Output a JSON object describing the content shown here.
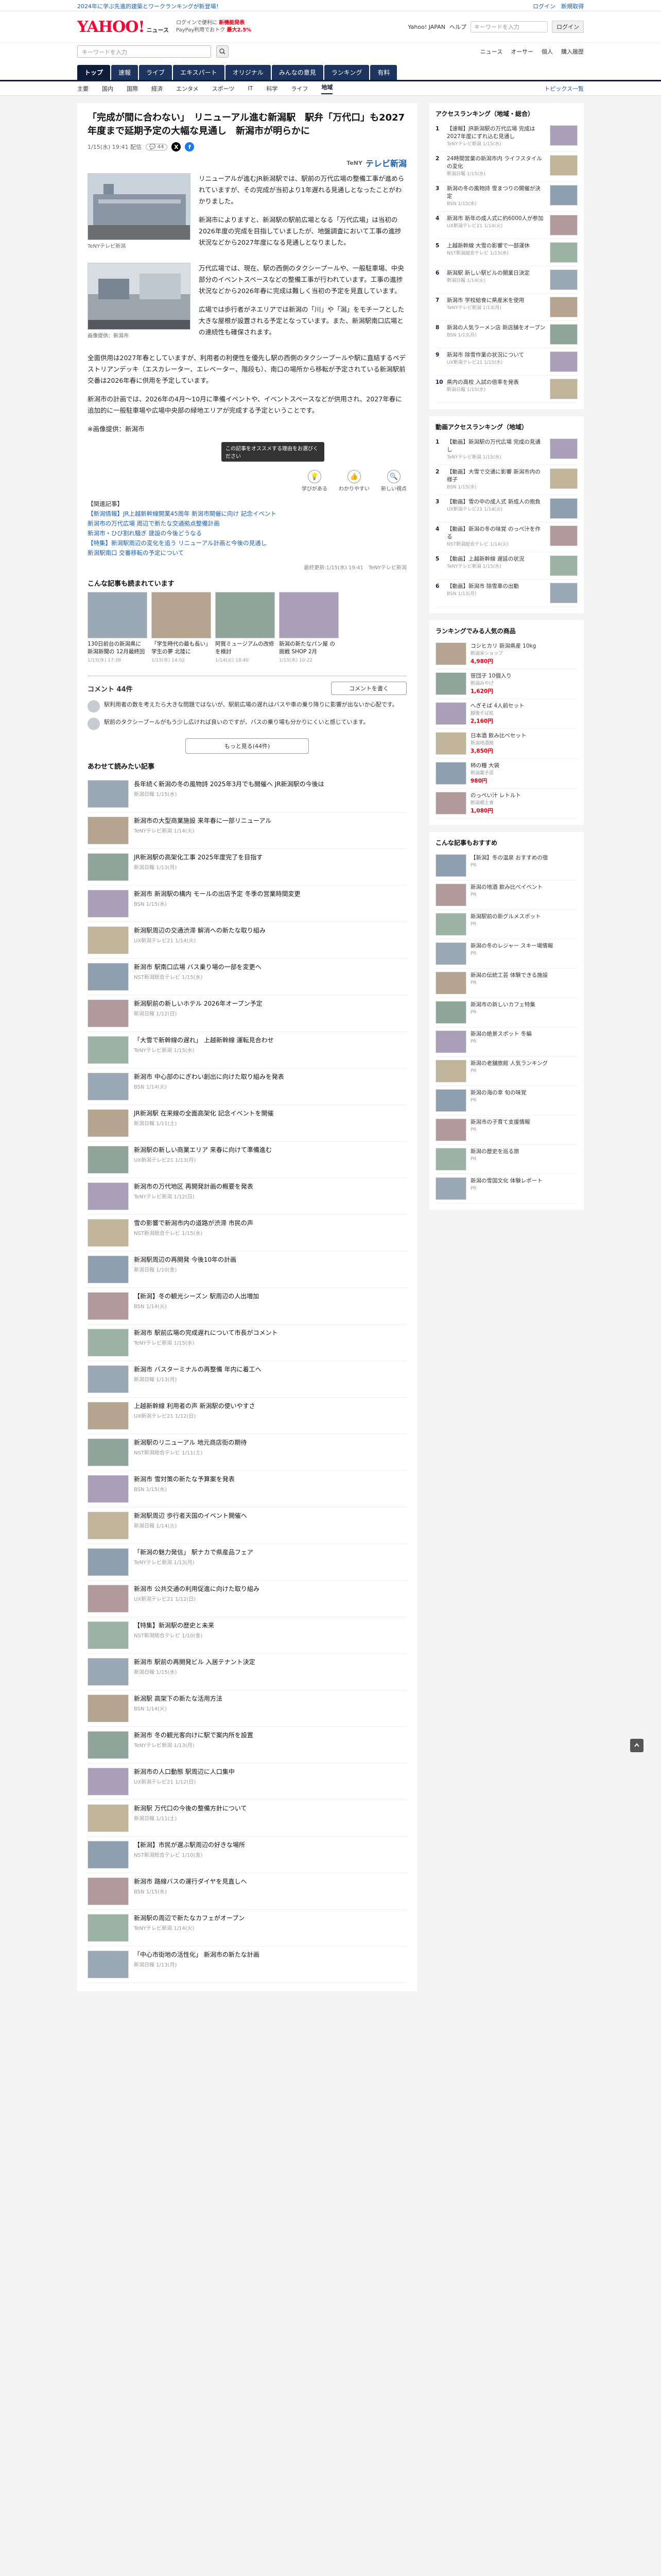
{
  "topbanner": {
    "left": "2024年に学ぶ先進的建築とワークランキングが新登場！",
    "right": "ログイン　新規取得"
  },
  "header": {
    "logo": "YAHOO!",
    "logo_sub": "ニュース",
    "links": [
      "ログインで便利に",
      "新機能発表",
      "PayPay利用でおトク",
      "最大2.5%"
    ],
    "top_links": [
      "Yahoo! JAPAN",
      "ヘルプ"
    ],
    "search_placeholder": "キーワードを入力",
    "login": "ログイン"
  },
  "searchbar": {
    "placeholder": "キーワードを入力",
    "right": [
      "ニュース",
      "オーサー",
      "個人",
      "購入履歴"
    ]
  },
  "nav": {
    "tabs": [
      "トップ",
      "速報",
      "ライブ",
      "エキスパート",
      "オリジナル",
      "みんなの意見",
      "ランキング",
      "有料"
    ],
    "active": 0
  },
  "subnav": {
    "items": [
      "主要",
      "国内",
      "国際",
      "経済",
      "エンタメ",
      "スポーツ",
      "IT",
      "科学",
      "ライフ",
      "地域"
    ],
    "active": 9,
    "pickup": "トピックス一覧"
  },
  "article": {
    "title": "「完成が間に合わない」　リニューアル進む新潟駅　駅弁「万代口」も2027年度まで延期予定の大幅な見通し　新潟市が明らかに",
    "datetime": "1/15(水) 19:41 配信",
    "comments": "44",
    "provider": "テレビ新潟",
    "paragraphs": [
      "リニューアルが進むJR新潟駅では、駅前の万代広場の整備工事が進められていますが、その完成が当初より1年遅れる見通しとなったことがわかりました。",
      "新潟市によりますと、新潟駅の駅前広場となる「万代広場」は当初の2026年度の完成を目指していましたが、地盤調査において工事の進捗状況などから2027年度になる見通しとなりました。",
      "万代広場では、現在、駅の西側のタクシープールや、一般駐車場、中央部分のイベントスペースなどの整備工事が行われています。工事の進捗状況などから2026年春に完成は難しく当初の予定を見直しています。",
      "広場では歩行者がネエリアでは新潟の「川」や「潟」をモチーフとした大きな屋根が設置される予定となっています。また、新潟駅南口広場との連続性も確保されます。",
      "全面供用は2027年春としていますが、利用者の利便性を優先し駅の西側のタクシープールや駅に直結するペデストリアンデッキ（エスカレーター、エレベーター、階段も）、南口の場所から移転が予定されている新潟駅前交番は2026年春に供用を予定しています。",
      "新潟市の計画では、2026年の4月〜10月に準備イベントや、イベントスペースなどが供用され、2027年春に追加的に一般駐車場や広場中央部の緑地エリアが完成する予定ということです。"
    ],
    "image_caption": "TeNYテレビ新潟",
    "image_caption2": "画像提供：新潟市",
    "image_source": "※画像提供：新潟市",
    "reactions": [
      {
        "label": "学びがある",
        "icon": "💡"
      },
      {
        "label": "わかりやすい",
        "icon": "👍"
      },
      {
        "label": "新しい視点",
        "icon": "🔍"
      }
    ],
    "reaction_tip": "この記事をオススメする理由をお選びください",
    "related_label": "【関連記事】",
    "related": [
      "【新潟情報】JR上越新幹線開業45周年 新潟市開催に向け 記念イベント",
      "新潟市の万代広場 周辺で新たな交通拠点整備計画",
      "新潟市・ひび割れ騒ぎ 建設の今後どうなる",
      "【特集】新潟駅周辺の変化を追う リニューアル計画と今後の見通し",
      "新潟駅南口 交番移転の予定について"
    ],
    "rights": "最終更新:1/15(水) 19:41　TeNYテレビ新潟"
  },
  "related_cards": {
    "title": "こんな記事も読まれています",
    "items": [
      {
        "text": "130日前台の新潟県に 新潟新聞の 12月最終回",
        "time": "1/15(水) 17:38"
      },
      {
        "text": "「学生時代の最も長い」 学生の夢 北陸に",
        "time": "1/15(水) 14:02"
      },
      {
        "text": "阿賀ミュージアムの改修を検討",
        "time": "1/14(火) 18:40"
      },
      {
        "text": "新潟の新たなパン屋 の挑戦 SHOP 2月",
        "time": "1/15(水) 10:22"
      }
    ]
  },
  "comments": {
    "title": "コメント 44件",
    "write_btn": "コメントを書く",
    "items": [
      "駅利用者の数を考えたら大きな問題ではないが、駅前広場の遅れはバスや車の乗り降りに影響が出ないか心配です。",
      "駅前のタクシープールがもう少し広ければ良いのですが、バスの乗り場も分かりにくいと感じています。"
    ],
    "more": "もっと見る(44件)"
  },
  "more_articles": {
    "title": "あわせて読みたい記事",
    "items": [
      {
        "text": "長年続く新潟の冬の風物詩 2025年3月でも開催へ JR新潟駅の今後は",
        "src": "新潟日報 1/15(水)"
      },
      {
        "text": "新潟市の大型商業施設 来年春に一部リニューアル",
        "src": "TeNYテレビ新潟 1/14(火)"
      },
      {
        "text": "JR新潟駅の高架化工事 2025年度完了を目指す",
        "src": "新潟日報 1/13(月)"
      },
      {
        "text": "新潟市 新潟駅の構内 モールの出店予定 冬季の営業時間変更",
        "src": "BSN 1/15(水)"
      },
      {
        "text": "新潟駅周辺の交通渋滞 解消への新たな取り組み",
        "src": "UX新潟テレビ21 1/14(火)"
      },
      {
        "text": "新潟市 駅南口広場 バス乗り場の一部を変更へ",
        "src": "NST新潟総合テレビ 1/15(水)"
      },
      {
        "text": "新潟駅前の新しいホテル 2026年オープン予定",
        "src": "新潟日報 1/12(日)"
      },
      {
        "text": "「大雪で新幹線の遅れ」 上越新幹線 運転見合わせ",
        "src": "TeNYテレビ新潟 1/15(水)"
      },
      {
        "text": "新潟市 中心部のにぎわい創出に向けた取り組みを発表",
        "src": "BSN 1/14(火)"
      },
      {
        "text": "JR新潟駅 在来線の全面高架化 記念イベントを開催",
        "src": "新潟日報 1/11(土)"
      },
      {
        "text": "新潟駅の新しい商業エリア 来春に向けて準備進む",
        "src": "UX新潟テレビ21 1/13(月)"
      },
      {
        "text": "新潟市の万代地区 再開発計画の概要を発表",
        "src": "TeNYテレビ新潟 1/12(日)"
      },
      {
        "text": "雪の影響で新潟市内の道路が渋滞 市民の声",
        "src": "NST新潟総合テレビ 1/15(水)"
      },
      {
        "text": "新潟駅周辺の再開発 今後10年の計画",
        "src": "新潟日報 1/10(金)"
      },
      {
        "text": "【新潟】冬の観光シーズン 駅周辺の人出増加",
        "src": "BSN 1/14(火)"
      },
      {
        "text": "新潟市 駅前広場の完成遅れについて市長がコメント",
        "src": "TeNYテレビ新潟 1/15(水)"
      },
      {
        "text": "新潟市 バスターミナルの再整備 年内に着工へ",
        "src": "新潟日報 1/13(月)"
      },
      {
        "text": "上越新幹線 利用者の声 新潟駅の使いやすさ",
        "src": "UX新潟テレビ21 1/12(日)"
      },
      {
        "text": "新潟駅のリニューアル 地元商店街の期待",
        "src": "NST新潟総合テレビ 1/11(土)"
      },
      {
        "text": "新潟市 雪対策の新たな予算案を発表",
        "src": "BSN 1/15(水)"
      },
      {
        "text": "新潟駅周辺 歩行者天国のイベント開催へ",
        "src": "新潟日報 1/14(火)"
      },
      {
        "text": "「新潟の魅力発信」 駅ナカで県産品フェア",
        "src": "TeNYテレビ新潟 1/13(月)"
      },
      {
        "text": "新潟市 公共交通の利用促進に向けた取り組み",
        "src": "UX新潟テレビ21 1/12(日)"
      },
      {
        "text": "【特集】新潟駅の歴史と未来",
        "src": "NST新潟総合テレビ 1/10(金)"
      },
      {
        "text": "新潟市 駅前の再開発ビル 入居テナント決定",
        "src": "新潟日報 1/15(水)"
      },
      {
        "text": "新潟駅 高架下の新たな活用方法",
        "src": "BSN 1/14(火)"
      },
      {
        "text": "新潟市 冬の観光客向けに駅で案内所を設置",
        "src": "TeNYテレビ新潟 1/13(月)"
      },
      {
        "text": "新潟市の人口動態 駅周辺に人口集中",
        "src": "UX新潟テレビ21 1/12(日)"
      },
      {
        "text": "新潟駅 万代口の今後の整備方針について",
        "src": "新潟日報 1/11(土)"
      },
      {
        "text": "【新潟】市民が選ぶ駅周辺の好きな場所",
        "src": "NST新潟総合テレビ 1/10(金)"
      },
      {
        "text": "新潟市 路線バスの運行ダイヤを見直しへ",
        "src": "BSN 1/15(水)"
      },
      {
        "text": "新潟駅の周辺で新たなカフェがオープン",
        "src": "TeNYテレビ新潟 1/14(火)"
      },
      {
        "text": "「中心市街地の活性化」 新潟市の新たな計画",
        "src": "新潟日報 1/13(月)"
      }
    ]
  },
  "sidebar": {
    "ranking_title": "アクセスランキング（地域・総合）",
    "ranking": [
      {
        "text": "【速報】JR新潟駅の万代広場 完成は2027年度にずれ込む見通し",
        "src": "TeNYテレビ新潟 1/15(水)"
      },
      {
        "text": "24時間営業の新潟市内 ライフスタイルの変化",
        "src": "新潟日報 1/15(水)"
      },
      {
        "text": "新潟の冬の風物詩 雪まつりの開催が決定",
        "src": "BSN 1/15(水)"
      },
      {
        "text": "新潟市 新年の成人式に約6000人が参加",
        "src": "UX新潟テレビ21 1/14(火)"
      },
      {
        "text": "上越新幹線 大雪の影響で一部運休",
        "src": "NST新潟総合テレビ 1/15(水)"
      },
      {
        "text": "新潟駅 新しい駅ビルの開業日決定",
        "src": "新潟日報 1/14(火)"
      },
      {
        "text": "新潟市 学校給食に県産米を使用",
        "src": "TeNYテレビ新潟 1/13(月)"
      },
      {
        "text": "新潟の人気ラーメン店 新店舗をオープン",
        "src": "BSN 1/13(月)"
      },
      {
        "text": "新潟市 除雪作業の状況について",
        "src": "UX新潟テレビ21 1/15(水)"
      },
      {
        "text": "県内の高校 入試の倍率を発表",
        "src": "新潟日報 1/15(水)"
      }
    ],
    "ranking2_title": "動画アクセスランキング（地域）",
    "ranking2": [
      {
        "text": "【動画】新潟駅の万代広場 完成の見通し",
        "src": "TeNYテレビ新潟 1/15(水)"
      },
      {
        "text": "【動画】大雪で交通に影響 新潟市内の様子",
        "src": "BSN 1/15(水)"
      },
      {
        "text": "【動画】雪の中の成人式 新成人の抱負",
        "src": "UX新潟テレビ21 1/14(火)"
      },
      {
        "text": "【動画】新潟の冬の味覚 のっぺ汁を作る",
        "src": "NST新潟総合テレビ 1/14(火)"
      },
      {
        "text": "【動画】上越新幹線 遅延の状況",
        "src": "TeNYテレビ新潟 1/15(水)"
      },
      {
        "text": "【動画】新潟市 除雪車の出動",
        "src": "BSN 1/13(月)"
      }
    ],
    "shop_title": "ランキングでみる人気の商品",
    "shop": [
      {
        "text": "コシヒカリ 新潟県産 10kg",
        "shop": "新潟米ショップ",
        "price": "4,980円"
      },
      {
        "text": "笹団子 10個入り",
        "shop": "新潟みやげ",
        "price": "1,620円"
      },
      {
        "text": "へぎそば 4人前セット",
        "shop": "越後そば処",
        "price": "2,160円"
      },
      {
        "text": "日本酒 飲み比べセット",
        "shop": "新潟地酒館",
        "price": "3,850円"
      },
      {
        "text": "柿の種 大袋",
        "shop": "新潟菓子店",
        "price": "980円"
      },
      {
        "text": "のっぺい汁 レトルト",
        "shop": "新潟郷土食",
        "price": "1,080円"
      }
    ],
    "pickup_title": "こんな記事もおすすめ",
    "pickup": [
      {
        "text": "【新潟】冬の温泉 おすすめの宿",
        "src": "PR"
      },
      {
        "text": "新潟の地酒 飲み比べイベント",
        "src": "PR"
      },
      {
        "text": "新潟駅前の新グルメスポット",
        "src": "PR"
      },
      {
        "text": "新潟の冬のレジャー スキー場情報",
        "src": "PR"
      },
      {
        "text": "新潟の伝統工芸 体験できる施設",
        "src": "PR"
      },
      {
        "text": "新潟市の新しいカフェ特集",
        "src": "PR"
      },
      {
        "text": "新潟の絶景スポット 冬編",
        "src": "PR"
      },
      {
        "text": "新潟の老舗旅館 人気ランキング",
        "src": "PR"
      },
      {
        "text": "新潟の海の幸 旬の味覚",
        "src": "PR"
      },
      {
        "text": "新潟市の子育て支援情報",
        "src": "PR"
      },
      {
        "text": "新潟の歴史を巡る旅",
        "src": "PR"
      },
      {
        "text": "新潟の雪国文化 体験レポート",
        "src": "PR"
      }
    ]
  }
}
